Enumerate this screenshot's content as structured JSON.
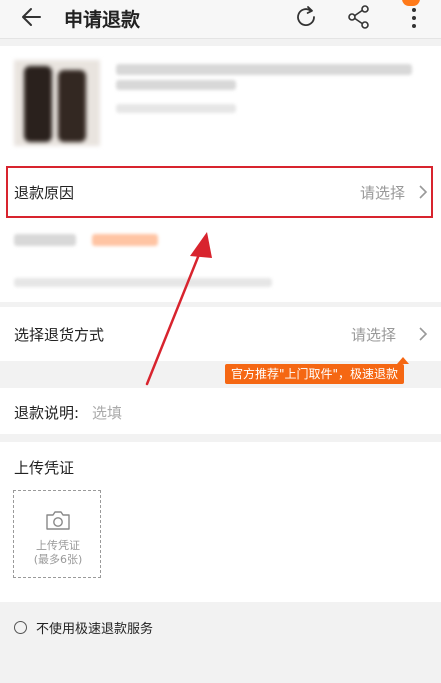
{
  "header": {
    "title": "申请退款",
    "accent_color": "#ff7a1a"
  },
  "form": {
    "refund_reason": {
      "label": "退款原因",
      "hint": "请选择"
    },
    "return_method": {
      "label": "选择退货方式",
      "hint": "请选择"
    },
    "promo_tooltip": "官方推荐\"上门取件\"，极速退款",
    "refund_note": {
      "label": "退款说明:",
      "placeholder": "选填"
    },
    "upload": {
      "title": "上传凭证",
      "box_line1": "上传凭证",
      "box_line2": "(最多6张)"
    },
    "fast_refund_option": "不使用极速退款服务"
  },
  "colors": {
    "highlight_border": "#d8242e",
    "annotation_arrow": "#d8242e",
    "tooltip_bg": "#f56713"
  }
}
